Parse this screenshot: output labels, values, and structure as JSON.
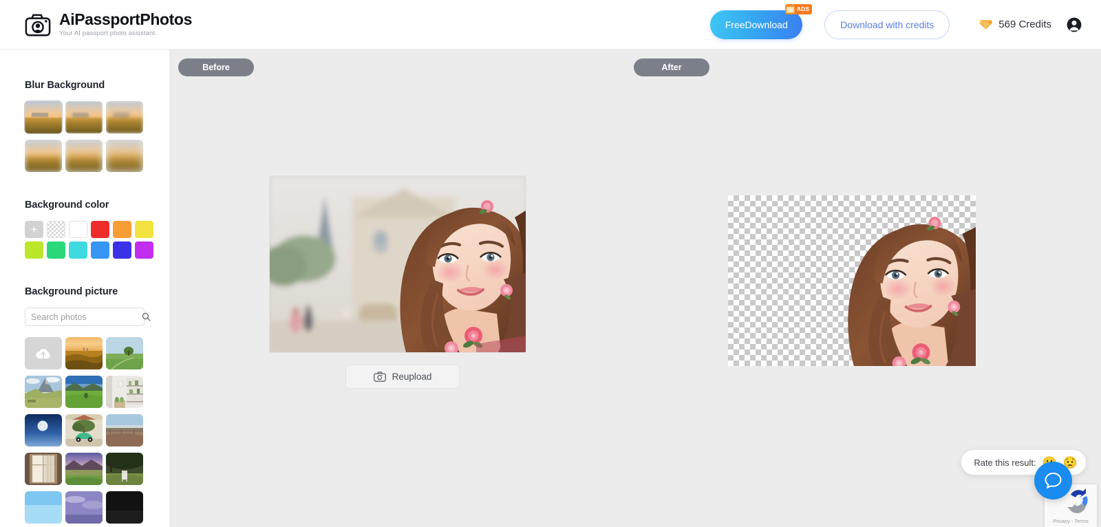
{
  "brand": {
    "title": "AiPassportPhotos",
    "tagline": "Your AI passport photo assistant.",
    "logo_icon": "camera-icon"
  },
  "header": {
    "free_download_label": "FreeDownload",
    "ads_badge_label": "ADS",
    "ads_badge_icon": "tv-icon",
    "download_credits_label": "Download with credits",
    "credits_value": "569 Credits",
    "gem_icon": "gem-icon",
    "avatar_icon": "user-avatar-icon",
    "accent_blue": "#35a8f0",
    "accent_orange": "#f47b20",
    "link_blue": "#5b7fe0"
  },
  "sidebar": {
    "blur_background": {
      "title": "Blur Background",
      "thumbs": [
        {
          "name": "blur-level-0",
          "level": 0,
          "selected": true
        },
        {
          "name": "blur-level-1",
          "level": 1,
          "selected": false
        },
        {
          "name": "blur-level-2",
          "level": 2,
          "selected": false
        },
        {
          "name": "blur-level-3",
          "level": 3,
          "selected": false
        },
        {
          "name": "blur-level-4",
          "level": 4,
          "selected": false
        },
        {
          "name": "blur-level-5",
          "level": 5,
          "selected": false
        }
      ]
    },
    "background_color": {
      "title": "Background color",
      "add_label": "+",
      "swatches": [
        {
          "name": "custom-color-picker",
          "color": "#d2d2d2",
          "kind": "plus"
        },
        {
          "name": "transparent",
          "color": "transparent",
          "kind": "checker"
        },
        {
          "name": "white",
          "color": "#ffffff",
          "kind": "white"
        },
        {
          "name": "red",
          "color": "#ee2c2c",
          "kind": "solid"
        },
        {
          "name": "orange",
          "color": "#f79d36",
          "kind": "solid"
        },
        {
          "name": "yellow",
          "color": "#f2e340",
          "kind": "solid"
        },
        {
          "name": "lime",
          "color": "#bbe62a",
          "kind": "solid"
        },
        {
          "name": "green",
          "color": "#2ad87a",
          "kind": "solid"
        },
        {
          "name": "cyan",
          "color": "#3fd9e0",
          "kind": "solid"
        },
        {
          "name": "blue",
          "color": "#3596f5",
          "kind": "solid"
        },
        {
          "name": "indigo",
          "color": "#3b32e8",
          "kind": "solid"
        },
        {
          "name": "magenta",
          "color": "#c12ef0",
          "kind": "solid"
        }
      ]
    },
    "background_picture": {
      "title": "Background picture",
      "search_placeholder": "Search photos",
      "search_value": "",
      "search_icon": "search-icon",
      "upload_icon": "cloud-upload-icon",
      "pictures": [
        {
          "name": "upload-photo",
          "kind": "upload",
          "alt": "Upload your own photo"
        },
        {
          "name": "photo-sunset-city",
          "kind": "sunset-city",
          "alt": "Golden sunset over city skyline"
        },
        {
          "name": "photo-lone-tree-field",
          "kind": "lone-tree",
          "alt": "Lone tree in green field"
        },
        {
          "name": "photo-mountain-peak",
          "kind": "mountain-peak",
          "alt": "Rocky mountain peak with meadow"
        },
        {
          "name": "photo-green-hills",
          "kind": "green-hills",
          "alt": "Green rolling hills under blue sky"
        },
        {
          "name": "photo-indoor-shelf",
          "kind": "indoor-shelf",
          "alt": "Bright indoor room with plant shelf"
        },
        {
          "name": "photo-full-moon",
          "kind": "full-moon",
          "alt": "Full moon in deep blue night sky"
        },
        {
          "name": "photo-green-car-tree",
          "kind": "green-car",
          "alt": "Green vintage car under a tree"
        },
        {
          "name": "photo-dry-field",
          "kind": "dry-field",
          "alt": "Dry open field with fence"
        },
        {
          "name": "photo-window-curtain",
          "kind": "window-curtain",
          "alt": "Sunlit window with sheer curtain"
        },
        {
          "name": "photo-purple-mountains",
          "kind": "purple-mountains",
          "alt": "Purple dusk over mountain valley"
        },
        {
          "name": "photo-chair-under-tree",
          "kind": "chair-tree",
          "alt": "White chair under a large tree"
        },
        {
          "name": "photo-clear-sky",
          "kind": "clear-sky",
          "alt": "Clear blue sky"
        },
        {
          "name": "photo-lavender-dusk",
          "kind": "lavender-dusk",
          "alt": "Lavender dusk clouds"
        },
        {
          "name": "photo-dark-scene",
          "kind": "dark-scene",
          "alt": "Dark night scene"
        }
      ]
    }
  },
  "canvas": {
    "before_label": "Before",
    "after_label": "After",
    "reupload_label": "Reupload",
    "reupload_icon": "camera-refresh-icon",
    "before_alt": "Portrait of a smiling woman with long brown hair and pink rose accessories in front of a blurred ornate building",
    "after_alt": "Same portrait with the background removed, shown over a transparent checkerboard",
    "background_color": "#ececec"
  },
  "rate_widget": {
    "label": "Rate this result:",
    "positive_emoji": "😀",
    "negative_emoji": "😟",
    "positive_name": "rate-positive",
    "negative_name": "rate-negative"
  },
  "chat": {
    "icon": "chat-bubble-icon",
    "color": "#1a8cf0"
  },
  "recaptcha": {
    "text": "Privacy - Terms",
    "icon": "recaptcha-icon"
  }
}
